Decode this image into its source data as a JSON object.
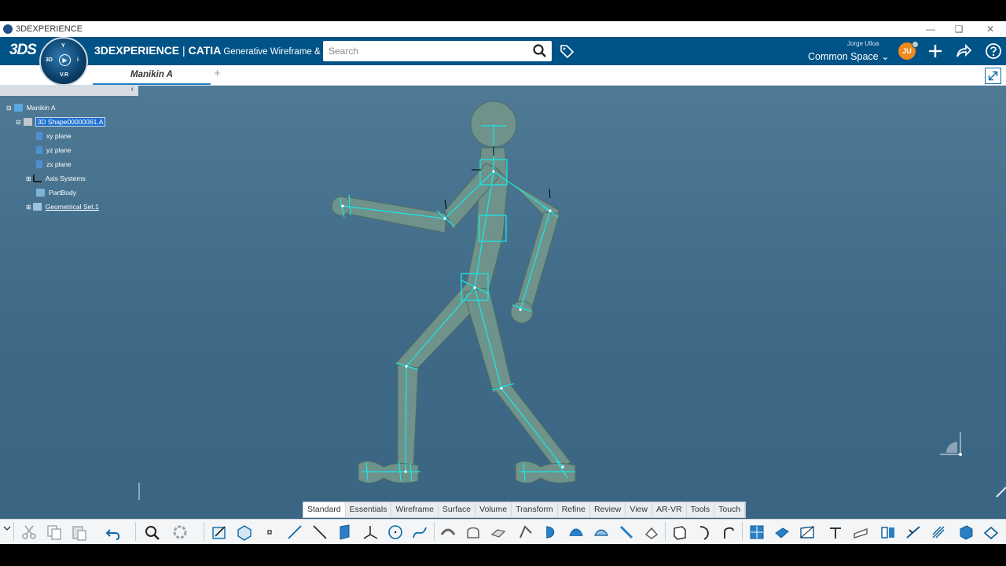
{
  "window": {
    "title": "3DEXPERIENCE"
  },
  "topbar": {
    "brand_main": "3DEXPERIENCE",
    "brand_sep": " | ",
    "brand_app": "CATIA",
    "brand_sub": "Generative Wireframe & Su...",
    "search_placeholder": "Search",
    "user_name": "Jorge Ulloa",
    "space": "Common Space",
    "avatar_initials": "JU",
    "compass_top": "Y",
    "compass_left": "3D",
    "compass_bottom": "V.R",
    "compass_right": "i"
  },
  "tabs": [
    {
      "label": "Manikin A"
    }
  ],
  "tree": {
    "root": "Manikin A",
    "items": [
      {
        "label": "3D Shape00000061.A",
        "selected": true
      },
      {
        "label": "xy plane"
      },
      {
        "label": "yz plane"
      },
      {
        "label": "zx plane"
      },
      {
        "label": "Axis Systems"
      },
      {
        "label": "PartBody"
      },
      {
        "label": "Geometrical Set.1"
      }
    ]
  },
  "action_sections": [
    "Standard",
    "Essentials",
    "Wireframe",
    "Surface",
    "Volume",
    "Transform",
    "Refine",
    "Review",
    "View",
    "AR-VR",
    "Tools",
    "Touch"
  ],
  "active_section": "Standard",
  "colors": {
    "topbar": "#005386",
    "viewport": "#466f8c",
    "body": "#6e9089",
    "skeleton": "#19e6e6"
  }
}
